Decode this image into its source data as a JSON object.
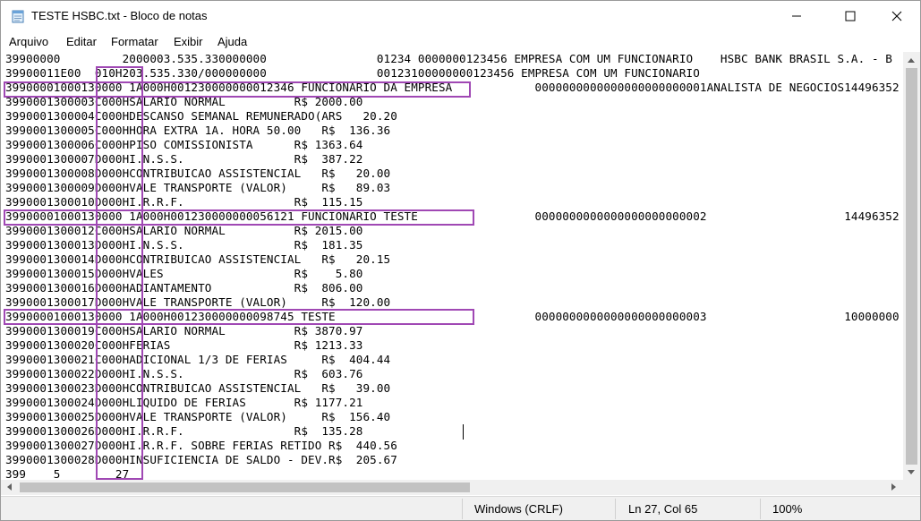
{
  "window": {
    "title": "TESTE HSBC.txt - Bloco de notas",
    "icon": "notepad-icon"
  },
  "menu": [
    "Arquivo",
    "Editar",
    "Formatar",
    "Exibir",
    "Ajuda"
  ],
  "editor": {
    "lines": [
      "39900000         2000003.535.330000000                01234 0000000123456 EMPRESA COM UM FUNCIONARIO    HSBC BANK BRASIL S.A. - B",
      "39900011E00  010H203.535.330/000000000                00123100000000123456 EMPRESA COM UM FUNCIONARIO",
      "39900001000130000 1A000H001230000000012346 FUNCIONARIO DA EMPRESA            0000000000000000000000001ANALISTA DE NEGOCIOS14496352",
      "3990001300003C000HSALARIO NORMAL          R$ 2000.00",
      "3990001300004C000HDESCANSO SEMANAL REMUNERADO(ARS   20.20",
      "3990001300005C000HHORA EXTRA 1A. HORA 50.00   R$  136.36",
      "3990001300006C000HPISO COMISSIONISTA      R$ 1363.64",
      "3990001300007D000HI.N.S.S.                R$  387.22",
      "3990001300008D000HCONTRIBUICAO ASSISTENCIAL   R$   20.00",
      "3990001300009D000HVALE TRANSPORTE (VALOR)     R$   89.03",
      "3990001300010D000HI.R.R.F.                R$  115.15",
      "39900001000130000 1A000H001230000000056121 FUNCIONARIO TESTE                 0000000000000000000000002                    14496352",
      "3990001300012C000HSALARIO NORMAL          R$ 2015.00",
      "3990001300013D000HI.N.S.S.                R$  181.35",
      "3990001300014D000HCONTRIBUICAO ASSISTENCIAL   R$   20.15",
      "3990001300015D000HVALES                   R$    5.80",
      "3990001300016D000HADIANTAMENTO            R$  806.00",
      "3990001300017D000HVALE TRANSPORTE (VALOR)     R$  120.00",
      "39900001000130000 1A000H001230000000098745 TESTE                             0000000000000000000000003                    10000000",
      "3990001300019C000HSALARIO NORMAL          R$ 3870.97",
      "3990001300020C000HFERIAS                  R$ 1213.33",
      "3990001300021C000HADICIONAL 1/3 DE FERIAS     R$  404.44",
      "3990001300022D000HI.N.S.S.                R$  603.76",
      "3990001300023D000HCONTRIBUICAO ASSISTENCIAL   R$   39.00",
      "3990001300024D000HLIQUIDO DE FERIAS       R$ 1177.21",
      "3990001300025D000HVALE TRANSPORTE (VALOR)     R$  156.40",
      "3990001300026D000HI.R.R.F.                R$  135.28",
      "3990001300027D000HI.R.R.F. SOBRE FERIAS RETIDO R$  440.56",
      "3990001300028D000HINSUFICIENCIA DE SALDO - DEV.R$  205.67",
      "399    5        27"
    ]
  },
  "status": {
    "encoding": "Windows (CRLF)",
    "position": "Ln 27, Col 65",
    "zoom": "100%"
  },
  "highlight_color": "#a048b4"
}
